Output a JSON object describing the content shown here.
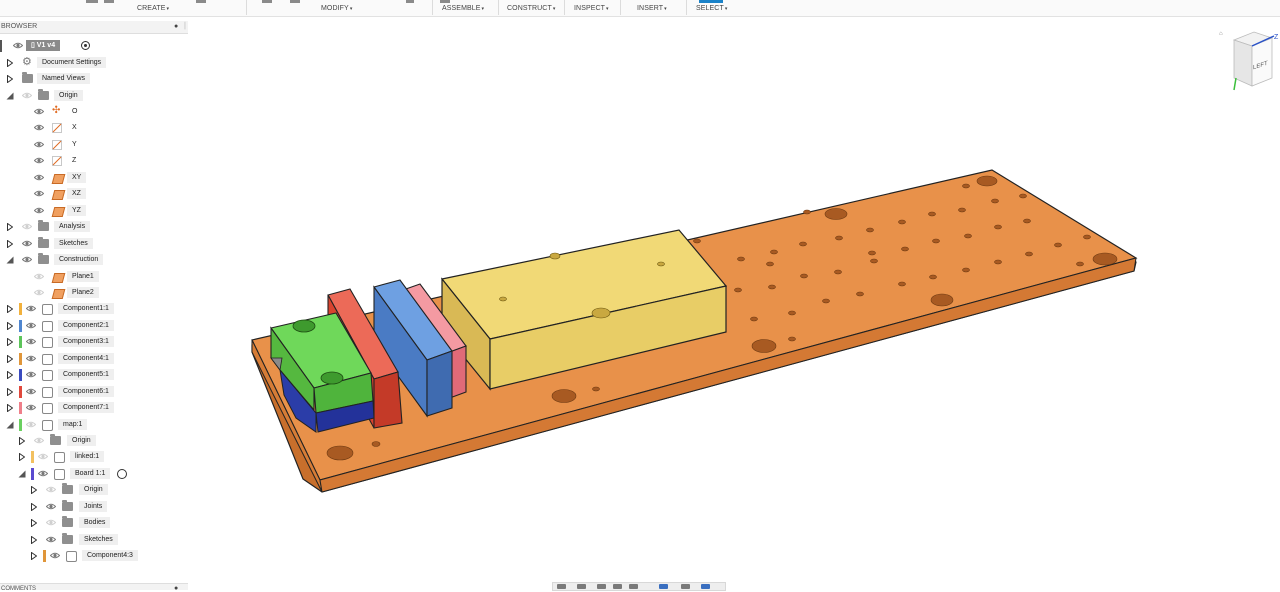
{
  "toolbar": {
    "menus": [
      {
        "label": "CREATE",
        "caret": "▾"
      },
      {
        "label": "MODIFY",
        "caret": "▾"
      },
      {
        "label": "ASSEMBLE",
        "caret": "▾"
      },
      {
        "label": "CONSTRUCT",
        "caret": "▾"
      },
      {
        "label": "INSPECT",
        "caret": "▾"
      },
      {
        "label": "INSERT",
        "caret": "▾"
      },
      {
        "label": "SELECT",
        "caret": "▾"
      }
    ]
  },
  "browser": {
    "title": "BROWSER",
    "header_button": "●",
    "collapse_button": "⏐",
    "root": {
      "label": "V1 v4"
    },
    "items": {
      "document_settings": "Document Settings",
      "named_views": "Named Views",
      "origin": "Origin",
      "origin_o": "O",
      "origin_x": "X",
      "origin_y": "Y",
      "origin_z": "Z",
      "origin_xy": "XY",
      "origin_xz": "XZ",
      "origin_yz": "YZ",
      "analysis": "Analysis",
      "sketches": "Sketches",
      "construction": "Construction",
      "plane1": "Plane1",
      "plane2": "Plane2",
      "component1": "Component1:1",
      "component2": "Component2:1",
      "component3": "Component3:1",
      "component4": "Component4:1",
      "component5": "Component5:1",
      "component6": "Component6:1",
      "component7": "Component7:1",
      "map": "map:1",
      "map_origin": "Origin",
      "linked": "linked:1",
      "board": "Board 1:1",
      "board_origin": "Origin",
      "board_joints": "Joints",
      "board_bodies": "Bodies",
      "board_sketches": "Sketches",
      "board_component4": "Component4:3"
    },
    "component_colors": {
      "component1": "#f2b13c",
      "component2": "#4f86d0",
      "component3": "#5cc45a",
      "component4": "#e0963a",
      "component5": "#3a4bbf",
      "component6": "#e0483c",
      "component7": "#ef7f8a",
      "map": "#6ad060",
      "linked": "#f2c060",
      "board": "#5a4ad0",
      "board_component4": "#e0963a"
    }
  },
  "comments": {
    "title": "COMMENTS",
    "button": "●"
  },
  "viewcube": {
    "face_label": "LEFT",
    "axis_z": "Z"
  },
  "model_colors": {
    "base_plate": "#e8914a",
    "yellow_block": "#e9cf6a",
    "blue_plate": "#5b8fd6",
    "pink_plate": "#ee7f8a",
    "red_plate": "#e4503f",
    "green_block": "#5fcc4e",
    "navy_block": "#2b3da8"
  }
}
